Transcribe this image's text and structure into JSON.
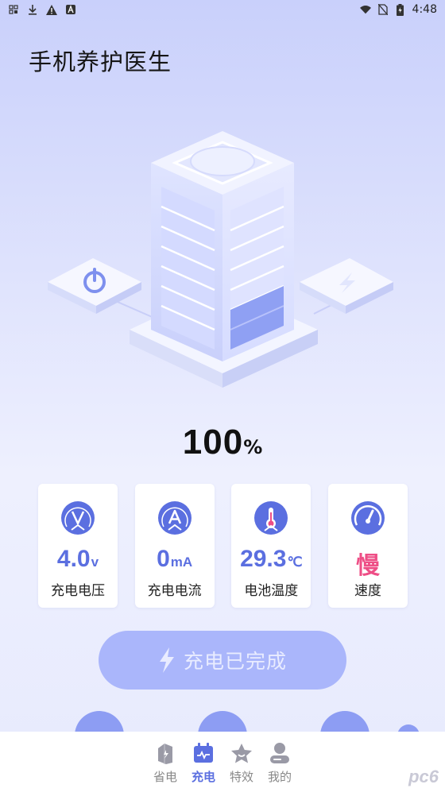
{
  "status_bar": {
    "time": "4:48"
  },
  "app": {
    "title": "手机养护医生"
  },
  "battery": {
    "percent": "100",
    "unit": "%"
  },
  "stats": [
    {
      "value": "4.0",
      "unit": "v",
      "label": "充电电压",
      "icon": "voltage-icon"
    },
    {
      "value": "0",
      "unit": "mA",
      "label": "充电电流",
      "icon": "current-icon"
    },
    {
      "value": "29.3",
      "unit": "℃",
      "label": "电池温度",
      "icon": "thermometer-icon"
    },
    {
      "value": "慢",
      "unit": "",
      "label": "速度",
      "icon": "speedometer-icon"
    }
  ],
  "charge_button": {
    "label": "充电已完成"
  },
  "nav": [
    {
      "label": "省电",
      "icon": "battery-save-icon",
      "active": false
    },
    {
      "label": "充电",
      "icon": "charge-calendar-icon",
      "active": true
    },
    {
      "label": "特效",
      "icon": "star-icon",
      "active": false
    },
    {
      "label": "我的",
      "icon": "user-icon",
      "active": false
    }
  ],
  "watermark": "pc6",
  "colors": {
    "accent": "#5b6fe0",
    "slow": "#ee4e86",
    "button": "#aab6fb"
  }
}
